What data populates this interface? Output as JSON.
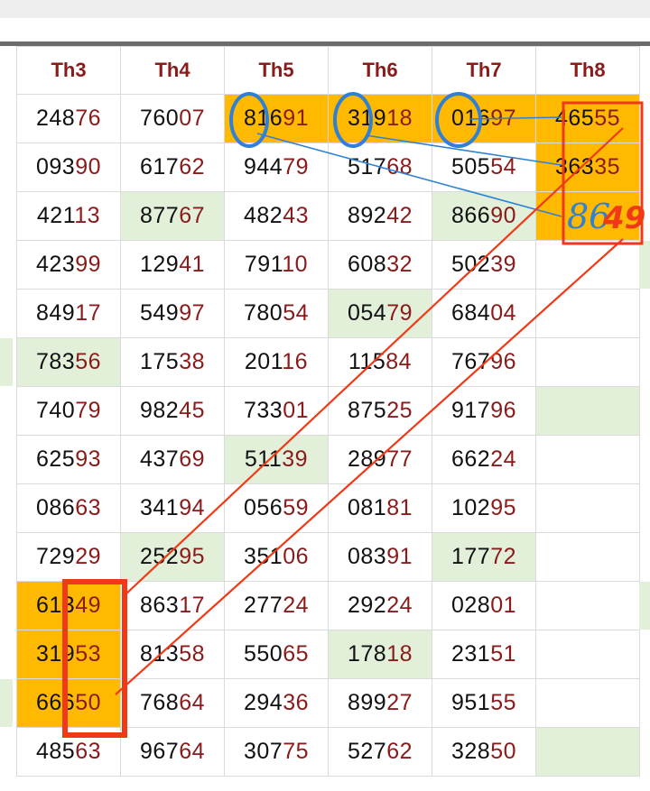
{
  "headers": [
    "Th3",
    "Th4",
    "Th5",
    "Th6",
    "Th7",
    "Th8"
  ],
  "rows": [
    [
      [
        "248",
        "76"
      ],
      [
        "760",
        "07"
      ],
      [
        "816",
        "91"
      ],
      [
        "319",
        "18"
      ],
      [
        "016",
        "97"
      ],
      [
        "465",
        "55"
      ]
    ],
    [
      [
        "093",
        "90"
      ],
      [
        "617",
        "62"
      ],
      [
        "944",
        "79"
      ],
      [
        "517",
        "68"
      ],
      [
        "505",
        "54"
      ],
      [
        "363",
        "35"
      ]
    ],
    [
      [
        "421",
        "13"
      ],
      [
        "877",
        "67"
      ],
      [
        "482",
        "43"
      ],
      [
        "892",
        "42"
      ],
      [
        "866",
        "90"
      ],
      [
        "",
        ""
      ]
    ],
    [
      [
        "423",
        "99"
      ],
      [
        "129",
        "41"
      ],
      [
        "791",
        "10"
      ],
      [
        "608",
        "32"
      ],
      [
        "502",
        "39"
      ],
      [
        "",
        ""
      ]
    ],
    [
      [
        "849",
        "17"
      ],
      [
        "549",
        "97"
      ],
      [
        "780",
        "54"
      ],
      [
        "054",
        "79"
      ],
      [
        "684",
        "04"
      ],
      [
        "",
        ""
      ]
    ],
    [
      [
        "783",
        "56"
      ],
      [
        "175",
        "38"
      ],
      [
        "201",
        "16"
      ],
      [
        "115",
        "84"
      ],
      [
        "767",
        "96"
      ],
      [
        "",
        ""
      ]
    ],
    [
      [
        "740",
        "79"
      ],
      [
        "982",
        "45"
      ],
      [
        "733",
        "01"
      ],
      [
        "875",
        "25"
      ],
      [
        "917",
        "96"
      ],
      [
        "",
        ""
      ]
    ],
    [
      [
        "625",
        "93"
      ],
      [
        "437",
        "69"
      ],
      [
        "511",
        "39"
      ],
      [
        "289",
        "77"
      ],
      [
        "662",
        "24"
      ],
      [
        "",
        ""
      ]
    ],
    [
      [
        "086",
        "63"
      ],
      [
        "341",
        "94"
      ],
      [
        "056",
        "59"
      ],
      [
        "081",
        "81"
      ],
      [
        "102",
        "95"
      ],
      [
        "",
        ""
      ]
    ],
    [
      [
        "729",
        "29"
      ],
      [
        "252",
        "95"
      ],
      [
        "351",
        "06"
      ],
      [
        "083",
        "91"
      ],
      [
        "177",
        "72"
      ],
      [
        "",
        ""
      ]
    ],
    [
      [
        "613",
        "49"
      ],
      [
        "863",
        "17"
      ],
      [
        "277",
        "24"
      ],
      [
        "292",
        "24"
      ],
      [
        "028",
        "01"
      ],
      [
        "",
        ""
      ]
    ],
    [
      [
        "319",
        "53"
      ],
      [
        "813",
        "58"
      ],
      [
        "550",
        "65"
      ],
      [
        "178",
        "18"
      ],
      [
        "231",
        "51"
      ],
      [
        "",
        ""
      ]
    ],
    [
      [
        "666",
        "50"
      ],
      [
        "768",
        "64"
      ],
      [
        "294",
        "36"
      ],
      [
        "899",
        "27"
      ],
      [
        "951",
        "55"
      ],
      [
        "",
        ""
      ]
    ],
    [
      [
        "485",
        "63"
      ],
      [
        "967",
        "64"
      ],
      [
        "307",
        "75"
      ],
      [
        "527",
        "62"
      ],
      [
        "328",
        "50"
      ],
      [
        "",
        ""
      ]
    ]
  ],
  "cell_fill": [
    [
      "",
      "",
      "hl",
      "hl",
      "hl",
      "hl"
    ],
    [
      "",
      "",
      "",
      "",
      "",
      "hl"
    ],
    [
      "",
      "gr",
      "",
      "",
      "gr",
      "hl"
    ],
    [
      "",
      "",
      "",
      "",
      "",
      ""
    ],
    [
      "",
      "",
      "",
      "gr",
      "",
      ""
    ],
    [
      "gr",
      "",
      "",
      "",
      "",
      ""
    ],
    [
      "",
      "",
      "",
      "",
      "",
      "gr"
    ],
    [
      "",
      "",
      "gr",
      "",
      "",
      ""
    ],
    [
      "",
      "",
      "",
      "",
      "",
      ""
    ],
    [
      "",
      "gr",
      "",
      "",
      "gr",
      ""
    ],
    [
      "hl",
      "",
      "",
      "",
      "",
      ""
    ],
    [
      "hl",
      "",
      "",
      "gr",
      "",
      ""
    ],
    [
      "hl",
      "",
      "",
      "",
      "",
      ""
    ],
    [
      "",
      "",
      "",
      "",
      "",
      "gr"
    ]
  ],
  "annotations": {
    "handwritten_blue": "86",
    "handwritten_red": "49"
  },
  "colors": {
    "highlight": "#ffb900",
    "green_fill": "#e2f0da",
    "suffix_text": "#8b1a1a",
    "prefix_text": "#111111",
    "blue_ink": "#2f80d6",
    "red_ink": "#f03a17"
  }
}
